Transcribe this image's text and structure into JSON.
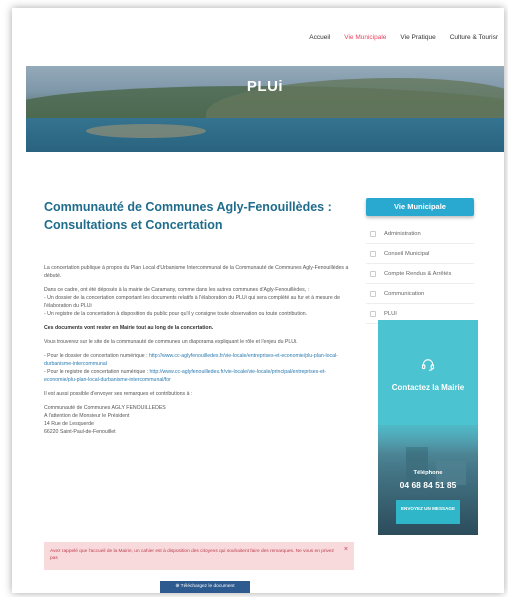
{
  "nav": {
    "items": [
      {
        "label": "Accueil",
        "active": false
      },
      {
        "label": "Vie Municipale",
        "active": true
      },
      {
        "label": "Vie Pratique",
        "active": false
      },
      {
        "label": "Culture & Tourisr",
        "active": false
      }
    ],
    "active_color": "#e8455f"
  },
  "hero": {
    "title": "PLUi"
  },
  "main": {
    "title": "Communauté de Communes Agly-Fenouillèdes : Consultations et Concertation",
    "p1": "La concertation publique à propos du Plan Local d'Urbanisme Intercommunal de la Communauté de Communes Agly-Fenouillèdes a débuté.",
    "p2_intro": "Dans ce cadre, ont été déposés à la mairie de Caramany, comme dans les autres communes d'Agly-Fenouillèdes, :",
    "p2_item1": "- Un dossier de la concertation comportant les documents relatifs à l'élaboration du PLUi qui sera complété au fur et à mesure de l'élaboration du PLUi",
    "p2_item2": "- Un registre de la concertation à disposition du public pour qu'il y consigne toute observation ou toute contribution.",
    "p3_bold": "Ces documents vont rester en Mairie tout au long de la concertation.",
    "p4": "Vous trouverez sur le site de la communauté de communes un diaporama expliquant le rôle et l'enjeu du PLUi.",
    "link1_label": "- Pour le dossier de concertation numérique :",
    "link1_url": "http://www.cc-aglyfenouilledes.fr/vie-locale/entreprises-et-economie/plu-plan-local-durbanisme-intercommunal",
    "link2_label": "- Pour le registre de concertation numérique :",
    "link2_url": "http://www.cc-aglyfenouilledes.fr/vie-locale/vie-locale/principal/entreprises-et-economie/plu-plan-local-durbanisme-intercommunal/for",
    "p5": "Il est aussi possible d'envoyer ses remarques et contributions à :",
    "address": [
      "Communauté de Communes AGLY FENOUILLEDES",
      "A l'attention de Monsieur le Président",
      "14 Rue de Lesquerde",
      "66220 Saint-Paul-de-Fenouillet"
    ],
    "alert": "Avez rappelé que l'accueil de la Mairie, un cahier est à disposition des citoyens qui souhaitent faire des remarques. Ne vous en privez pas",
    "alert_close": "×",
    "download_label": "⊕ Téléchargez le document"
  },
  "sidebar": {
    "header": "Vie Municipale",
    "items": [
      {
        "label": "Administration"
      },
      {
        "label": "Conseil Municipal"
      },
      {
        "label": "Compte Rendus & Arrêtés"
      },
      {
        "label": "Communication"
      },
      {
        "label": "PLUI"
      }
    ],
    "accent": "#29a8d0"
  },
  "contact": {
    "title": "Contactez la Mairie",
    "phone_label": "Téléphone",
    "phone_number": "04 68 84 51 85",
    "send_label": "ENVOYEZ UN MESSAGE",
    "color": "#4bc3d0"
  }
}
